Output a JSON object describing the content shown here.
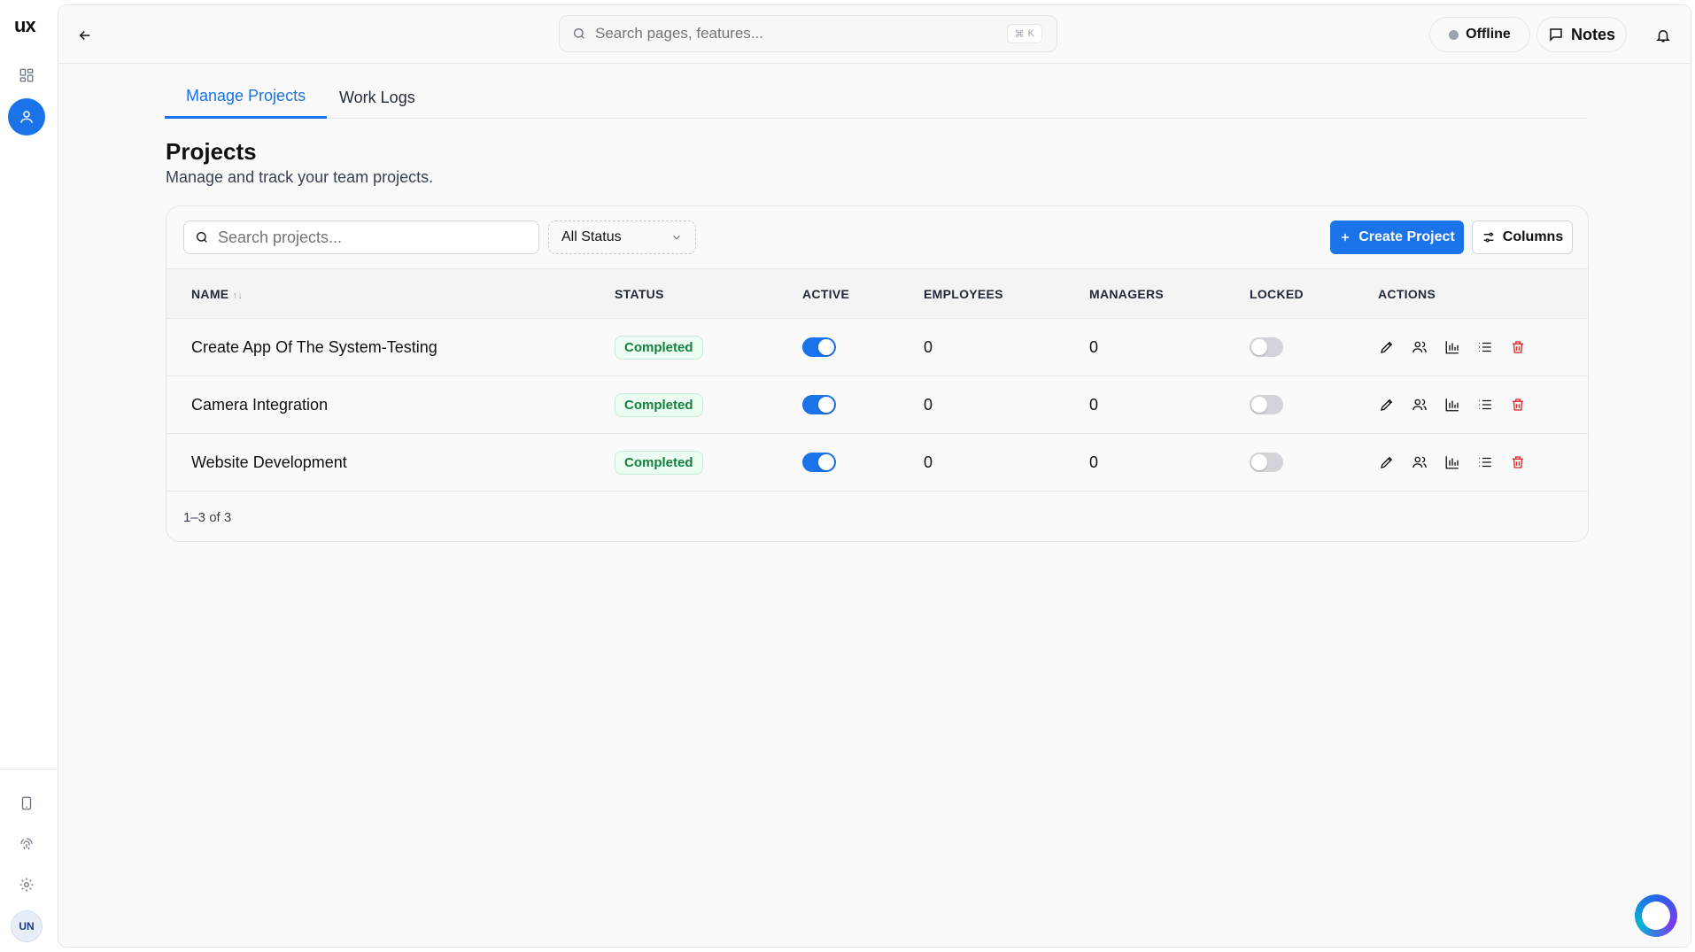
{
  "app": {
    "logo": "ux"
  },
  "rail": {
    "avatar_initials": "UN"
  },
  "topbar": {
    "search_placeholder": "Search pages, features...",
    "shortcut_symbol": "⌘",
    "shortcut_key": "K",
    "offline_label": "Offline",
    "notes_label": "Notes"
  },
  "tabs": [
    {
      "label": "Manage Projects",
      "active": true
    },
    {
      "label": "Work Logs",
      "active": false
    }
  ],
  "page": {
    "title": "Projects",
    "subtitle": "Manage and track your team projects."
  },
  "toolbar": {
    "search_placeholder": "Search projects...",
    "status_filter": "All Status",
    "create_label": "Create Project",
    "columns_label": "Columns"
  },
  "table": {
    "headers": {
      "name": "NAME",
      "sort_icon": "↑↓",
      "status": "STATUS",
      "active": "ACTIVE",
      "employees": "EMPLOYEES",
      "managers": "MANAGERS",
      "locked": "LOCKED",
      "actions": "ACTIONS"
    },
    "rows": [
      {
        "name": "Create App Of The System-Testing",
        "status": "Completed",
        "active": true,
        "employees": "0",
        "managers": "0",
        "locked": false
      },
      {
        "name": "Camera Integration",
        "status": "Completed",
        "active": true,
        "employees": "0",
        "managers": "0",
        "locked": false
      },
      {
        "name": "Website Development",
        "status": "Completed",
        "active": true,
        "employees": "0",
        "managers": "0",
        "locked": false
      }
    ],
    "pagination": "1–3 of 3"
  },
  "colors": {
    "accent": "#1a73e8",
    "success": "#15803d",
    "danger": "#dc2626"
  }
}
